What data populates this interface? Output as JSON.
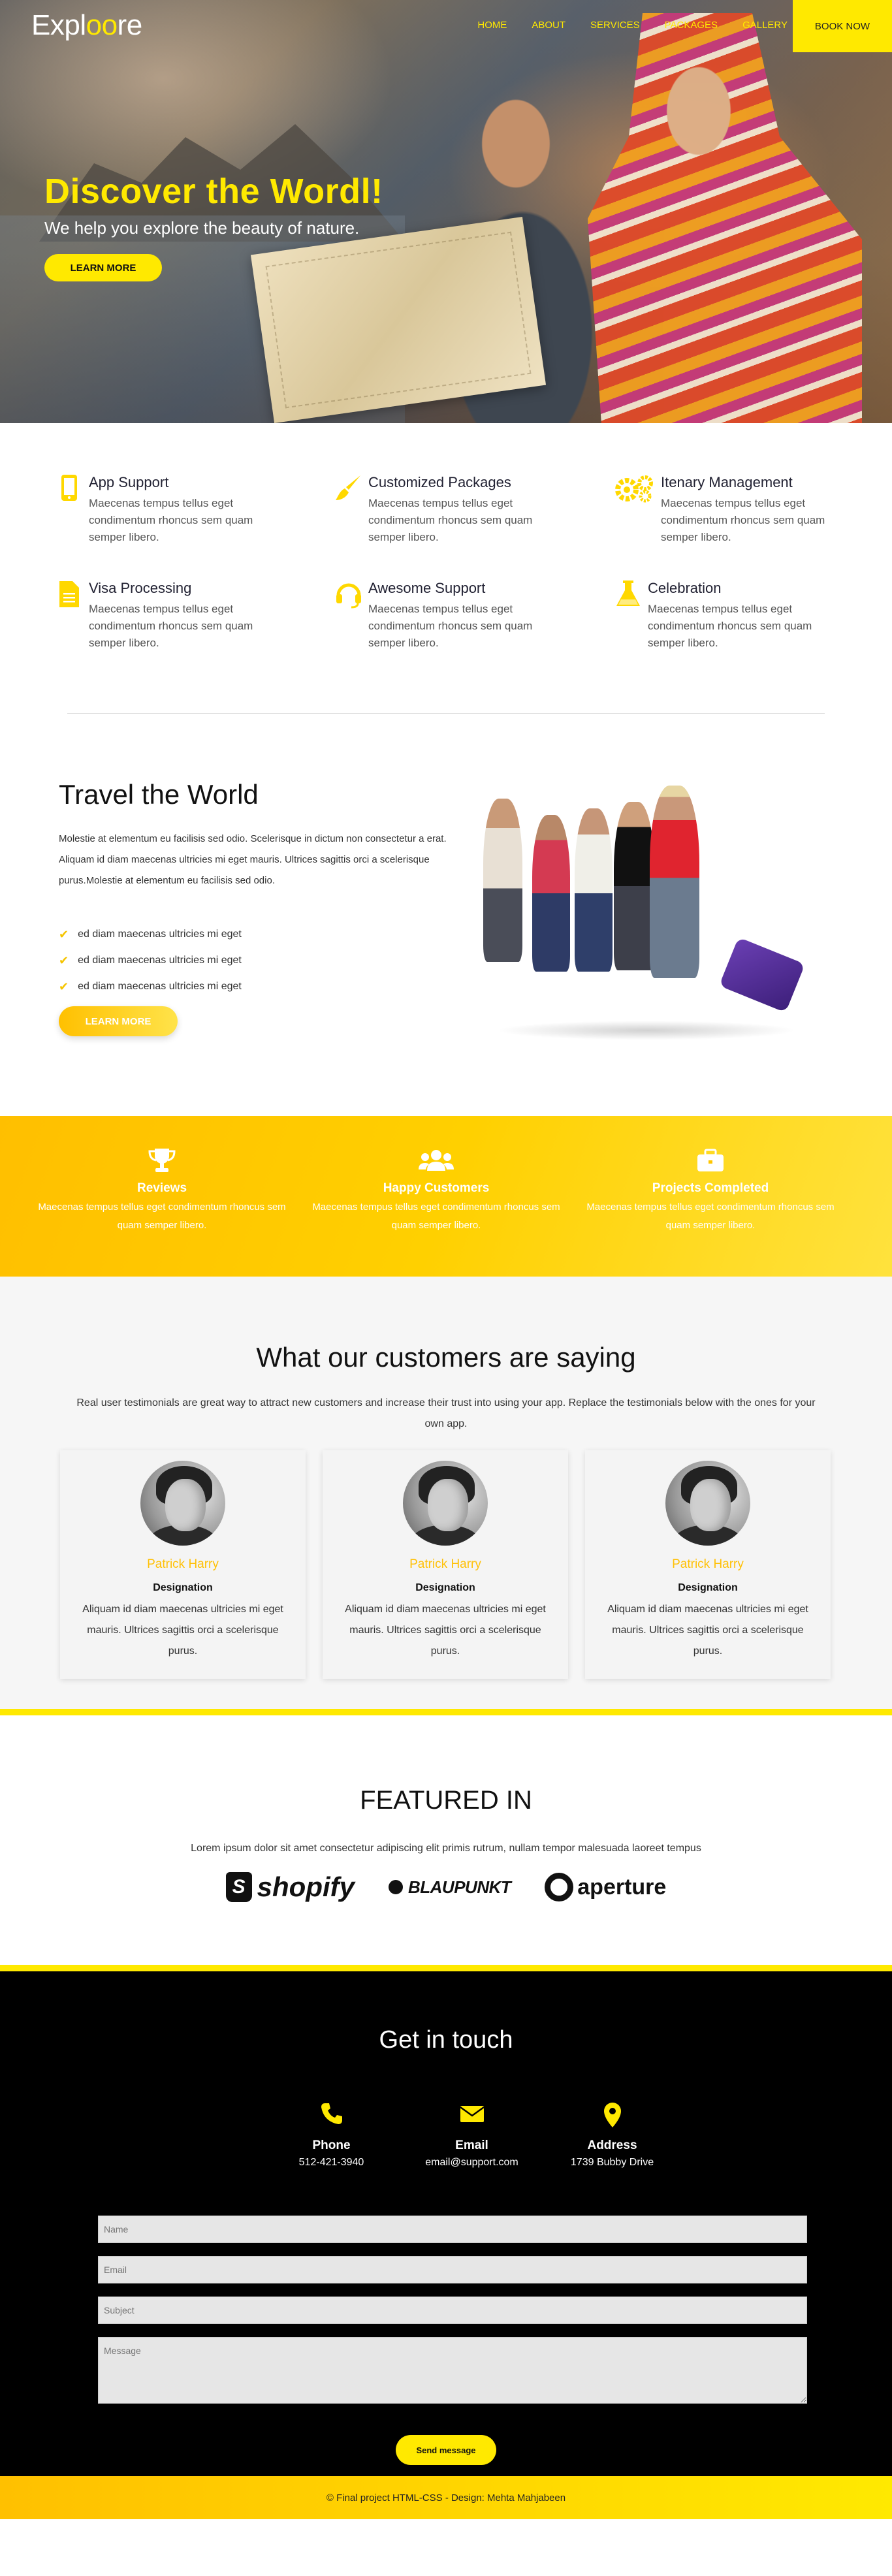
{
  "nav": {
    "logo": "Expl",
    "logo_oo": "oo",
    "logo_end": "re",
    "items": [
      "HOME",
      "ABOUT",
      "SERVICES",
      "PACKAGES",
      "GALLERY"
    ],
    "book": "BOOK NOW"
  },
  "hero": {
    "title": "Discover the Wordl!",
    "subtitle": "We help you explore the beauty of nature.",
    "button": "LEARN MORE"
  },
  "features": [
    {
      "icon": "mobile-icon",
      "title": "App Support",
      "text": "Maecenas tempus tellus eget condimentum rhoncus sem quam semper libero."
    },
    {
      "icon": "paintbrush-icon",
      "title": "Customized Packages",
      "text": "Maecenas tempus tellus eget condimentum rhoncus sem quam semper libero."
    },
    {
      "icon": "gears-icon",
      "title": "Itenary Management",
      "text": "Maecenas tempus tellus eget condimentum rhoncus sem quam semper libero."
    },
    {
      "icon": "document-icon",
      "title": "Visa Processing",
      "text": "Maecenas tempus tellus eget condimentum rhoncus sem quam semper libero."
    },
    {
      "icon": "headset-icon",
      "title": "Awesome Support",
      "text": "Maecenas tempus tellus eget condimentum rhoncus sem quam semper libero."
    },
    {
      "icon": "flask-icon",
      "title": "Celebration",
      "text": "Maecenas tempus tellus eget condimentum rhoncus sem quam semper libero."
    }
  ],
  "travel": {
    "title": "Travel the World",
    "para1": "Molestie at elementum eu facilisis sed odio. Scelerisque in dictum non consectetur a erat.",
    "para2": "Aliquam id diam maecenas ultricies mi eget mauris. Ultrices sagittis orci a scelerisque purus.Molestie at elementum eu facilisis sed odio.",
    "checks": [
      "ed diam maecenas ultricies mi eget",
      "ed diam maecenas ultricies mi eget",
      "ed diam maecenas ultricies mi eget"
    ],
    "button": "LEARN MORE"
  },
  "stats": [
    {
      "icon": "trophy-icon",
      "title": "Reviews",
      "text": "Maecenas tempus tellus eget condimentum rhoncus sem quam semper libero."
    },
    {
      "icon": "users-icon",
      "title": "Happy Customers",
      "text": "Maecenas tempus tellus eget condimentum rhoncus sem quam semper libero."
    },
    {
      "icon": "briefcase-icon",
      "title": "Projects Completed",
      "text": "Maecenas tempus tellus eget condimentum rhoncus sem quam semper libero."
    }
  ],
  "testimonials": {
    "title": "What our customers are saying",
    "lead": "Real user testimonials are great way to attract new customers and increase their trust into using your app. Replace the testimonials below with the ones for your own app.",
    "cards": [
      {
        "name": "Patrick Harry",
        "role": "Designation",
        "text": "Aliquam id diam maecenas ultricies mi eget mauris. Ultrices sagittis orci a scelerisque purus."
      },
      {
        "name": "Patrick Harry",
        "role": "Designation",
        "text": "Aliquam id diam maecenas ultricies mi eget mauris. Ultrices sagittis orci a scelerisque purus."
      },
      {
        "name": "Patrick Harry",
        "role": "Designation",
        "text": "Aliquam id diam maecenas ultricies mi eget mauris. Ultrices sagittis orci a scelerisque purus."
      }
    ]
  },
  "featured": {
    "title": "FEATURED IN",
    "lead": "Lorem ipsum dolor sit amet consectetur adipiscing elit primis rutrum, nullam tempor malesuada laoreet tempus",
    "brands": [
      "shopify",
      "BLAUPUNKT",
      "aperture"
    ]
  },
  "contact": {
    "title": "Get in touch",
    "info": [
      {
        "icon": "phone-icon",
        "label": "Phone",
        "value": "512-421-3940"
      },
      {
        "icon": "envelope-icon",
        "label": "Email",
        "value": "email@support.com"
      },
      {
        "icon": "map-pin-icon",
        "label": "Address",
        "value": "1739 Bubby Drive"
      }
    ],
    "placeholders": {
      "name": "Name",
      "email": "Email",
      "subject": "Subject",
      "message": "Message"
    },
    "send": "Send message"
  },
  "footer": "© Final project HTML-CSS - Design: Mehta Mahjabeen",
  "colors": {
    "accent": "#ffe900",
    "accent_dark": "#ffc000",
    "contact_bg": "#000000"
  }
}
